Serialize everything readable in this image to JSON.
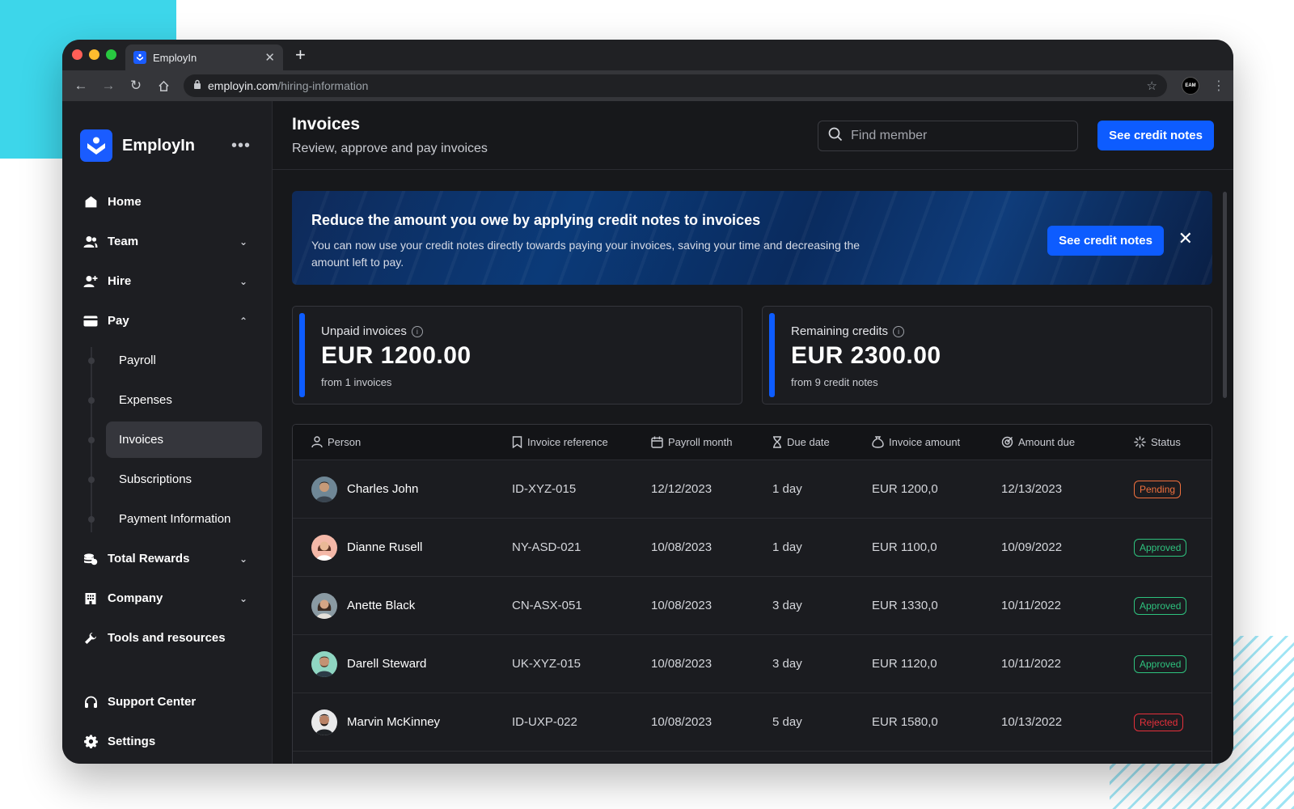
{
  "browser": {
    "tab_title": "EmployIn",
    "url_domain": "employin.com",
    "url_path": "/hiring-information",
    "profile_label": "EAM"
  },
  "sidebar": {
    "brand": "EmployIn",
    "more": "•••",
    "items": [
      {
        "label": "Home",
        "icon": "home-icon"
      },
      {
        "label": "Team",
        "icon": "team-icon",
        "expandable": true
      },
      {
        "label": "Hire",
        "icon": "hire-icon",
        "expandable": true
      },
      {
        "label": "Pay",
        "icon": "card-icon",
        "expanded": true
      }
    ],
    "pay_sub": [
      "Payroll",
      "Expenses",
      "Invoices",
      "Subscriptions",
      "Payment Information"
    ],
    "active_sub": "Invoices",
    "items_after": [
      {
        "label": "Total Rewards",
        "icon": "coins-icon"
      },
      {
        "label": "Company",
        "icon": "building-icon"
      },
      {
        "label": "Tools and resources",
        "icon": "wrench-icon"
      }
    ],
    "support": "Support Center",
    "settings": "Settings"
  },
  "header": {
    "title": "Invoices",
    "subtitle": "Review, approve and pay invoices",
    "search_placeholder": "Find member",
    "credit_button": "See credit notes"
  },
  "banner": {
    "title": "Reduce the amount you owe by applying credit notes to invoices",
    "text": "You can now use your credit notes directly towards paying your invoices, saving your time and decreasing the amount left to pay.",
    "button": "See credit notes"
  },
  "cards": [
    {
      "label": "Unpaid invoices",
      "value": "EUR 1200.00",
      "sub": "from 1 invoices"
    },
    {
      "label": "Remaining credits",
      "value": "EUR 2300.00",
      "sub": "from 9 credit notes"
    }
  ],
  "table": {
    "columns": [
      "Person",
      "Invoice reference",
      "Payroll month",
      "Due date",
      "Invoice amount",
      "Amount due",
      "Status"
    ],
    "rows": [
      {
        "person": "Charles John",
        "ref": "ID-XYZ-015",
        "month": "12/12/2023",
        "due": "1 day",
        "amount": "EUR 1200,0",
        "amount_due": "12/13/2023",
        "status": "Pending"
      },
      {
        "person": "Dianne Rusell",
        "ref": "NY-ASD-021",
        "month": "10/08/2023",
        "due": "1 day",
        "amount": "EUR 1100,0",
        "amount_due": "10/09/2022",
        "status": "Approved"
      },
      {
        "person": "Anette Black",
        "ref": "CN-ASX-051",
        "month": "10/08/2023",
        "due": "3 day",
        "amount": "EUR 1330,0",
        "amount_due": "10/11/2022",
        "status": "Approved"
      },
      {
        "person": "Darell Steward",
        "ref": "UK-XYZ-015",
        "month": "10/08/2023",
        "due": "3 day",
        "amount": "EUR 1120,0",
        "amount_due": "10/11/2022",
        "status": "Approved"
      },
      {
        "person": "Marvin McKinney",
        "ref": "ID-UXP-022",
        "month": "10/08/2023",
        "due": "5 day",
        "amount": "EUR 1580,0",
        "amount_due": "10/13/2022",
        "status": "Rejected"
      }
    ]
  },
  "colors": {
    "accent": "#0d5cff",
    "pending": "#f0703d",
    "approved": "#2ec27e",
    "rejected": "#e5303b"
  }
}
